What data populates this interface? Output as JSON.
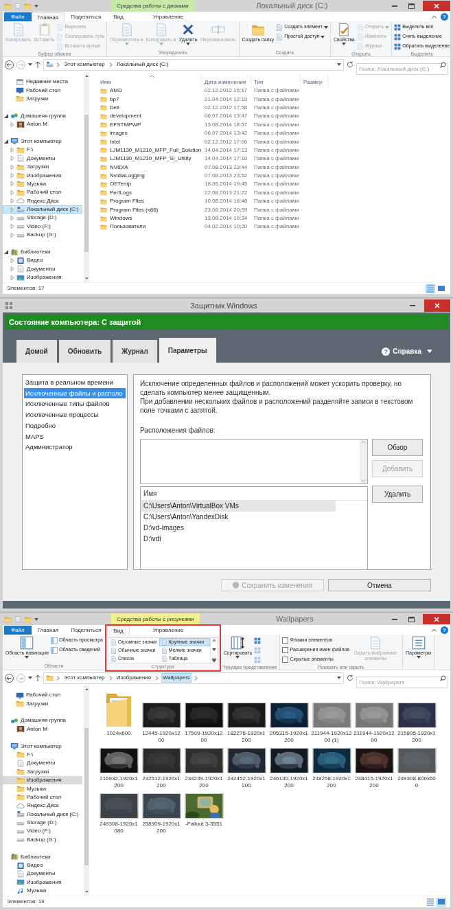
{
  "windows": [
    {
      "kind": "explorer",
      "title": "Локальный диск (C:)",
      "context_tab": {
        "label": "Средства работы с дисками",
        "color": "#c6e9a8"
      },
      "help_icon": "?",
      "tabs": [
        {
          "label": "Файл",
          "kind": "file",
          "selected": false
        },
        {
          "label": "Главная",
          "kind": "normal",
          "selected": true
        },
        {
          "label": "Поделиться",
          "kind": "normal",
          "selected": false
        },
        {
          "label": "Вид",
          "kind": "normal",
          "selected": false
        },
        {
          "label": "Управление",
          "kind": "context",
          "selected": false
        }
      ],
      "groups": [
        {
          "label": "Буфер обмена",
          "kind": "buttons",
          "commands": [
            {
              "label": "Копировать",
              "kind": "large",
              "disabled": true
            },
            {
              "label": "Вставить",
              "kind": "large",
              "disabled": true
            },
            {
              "label": "Вырезать",
              "kind": "small",
              "disabled": true
            },
            {
              "label": "Скопировать путь",
              "kind": "small",
              "disabled": true
            },
            {
              "label": "Вставить ярлык",
              "kind": "small",
              "disabled": true
            }
          ]
        },
        {
          "label": "Упорядочить",
          "kind": "buttons",
          "commands": [
            {
              "label": "Переместить в",
              "kind": "large",
              "disabled": true,
              "menu": true
            },
            {
              "label": "Копировать в",
              "kind": "large",
              "disabled": true,
              "menu": true
            },
            {
              "label": "Удалить",
              "kind": "large",
              "disabled": false,
              "menu": true
            },
            {
              "label": "Переименовать",
              "kind": "large",
              "disabled": true
            }
          ]
        },
        {
          "label": "Создать",
          "kind": "buttons",
          "commands": [
            {
              "label": "Создать папку",
              "kind": "large",
              "disabled": false
            },
            {
              "label": "Создать элемент",
              "kind": "small",
              "disabled": false,
              "menu": true
            },
            {
              "label": "Простой доступ",
              "kind": "small",
              "disabled": false,
              "menu": true
            }
          ]
        },
        {
          "label": "Открыть",
          "kind": "buttons",
          "commands": [
            {
              "label": "Свойства",
              "kind": "large",
              "disabled": false,
              "menu": true
            },
            {
              "label": "Открыть",
              "kind": "small",
              "disabled": true,
              "menu": true
            },
            {
              "label": "Изменить",
              "kind": "small",
              "disabled": true
            },
            {
              "label": "Журнал",
              "kind": "small",
              "disabled": true
            }
          ]
        },
        {
          "label": "Выделить",
          "kind": "buttons",
          "commands": [
            {
              "label": "Выделить все",
              "kind": "small",
              "disabled": false
            },
            {
              "label": "Снять выделение",
              "kind": "small",
              "disabled": false
            },
            {
              "label": "Обратить выделение",
              "kind": "small",
              "disabled": false
            }
          ]
        }
      ],
      "address": {
        "path": [
          {
            "label": "Этот компьютер",
            "selected": false
          },
          {
            "label": "Локальный диск (C:)",
            "selected": false
          }
        ],
        "search_placeholder": "Поиск: Локальный диск (C:)"
      },
      "nav": {
        "focused": true,
        "items": [
          {
            "label": "Недавние места",
            "kind": "place",
            "selected": false
          },
          {
            "label": "Рабочий стол",
            "kind": "desktop",
            "selected": false
          },
          {
            "label": "Загрузки",
            "kind": "folder",
            "selected": false
          },
          {
            "label": "Домашняя группа",
            "kind": "network",
            "selected": false,
            "expanded": true,
            "children": [
              {
                "label": "Anton M",
                "kind": "user",
                "selected": false,
                "expanded": false
              }
            ]
          },
          {
            "label": "Этот компьютер",
            "kind": "computer",
            "selected": false,
            "expanded": true,
            "children": [
              {
                "label": "F:\\",
                "kind": "folder",
                "selected": false,
                "expanded": false
              },
              {
                "label": "Документы",
                "kind": "documents",
                "selected": false,
                "expanded": false
              },
              {
                "label": "Загрузки",
                "kind": "folder",
                "selected": false,
                "expanded": false
              },
              {
                "label": "Изображения",
                "kind": "folder",
                "selected": false,
                "expanded": false
              },
              {
                "label": "Музыка",
                "kind": "folder",
                "selected": false,
                "expanded": false
              },
              {
                "label": "Рабочий стол",
                "kind": "folder",
                "selected": false,
                "expanded": false
              },
              {
                "label": "Яндекс.Диск",
                "kind": "cloud",
                "selected": false,
                "expanded": false
              },
              {
                "label": "Локальный диск (C:)",
                "kind": "system_drive",
                "selected": true,
                "expanded": false
              },
              {
                "label": "Storage (D:)",
                "kind": "drive",
                "selected": false,
                "expanded": false
              },
              {
                "label": "Video (F:)",
                "kind": "drive",
                "selected": false,
                "expanded": false
              },
              {
                "label": "Backup (G:)",
                "kind": "drive",
                "selected": false,
                "expanded": false
              }
            ]
          },
          {
            "label": "Библиотеки",
            "kind": "library",
            "selected": false,
            "expanded": true,
            "children": [
              {
                "label": "Видео",
                "kind": "video",
                "selected": false,
                "expanded": false
              },
              {
                "label": "Документы",
                "kind": "documents",
                "selected": false,
                "expanded": false
              },
              {
                "label": "Изображения",
                "kind": "pictures",
                "selected": false,
                "expanded": false
              }
            ]
          }
        ]
      },
      "view": {
        "kind": "details",
        "columns": [
          {
            "label": "Имя",
            "sorted": true
          },
          {
            "label": "Дата изменения",
            "sorted": false
          },
          {
            "label": "Тип",
            "sorted": false
          },
          {
            "label": "Размер",
            "sorted": false
          }
        ],
        "rows": [
          {
            "name": "AMD",
            "modified": "02.12.2012 16:17",
            "type": "Папка с файлами"
          },
          {
            "name": "bp7",
            "modified": "21.04.2014 12:10",
            "type": "Папка с файлами"
          },
          {
            "name": "Dell",
            "modified": "02.12.2012 17:58",
            "type": "Папка с файлами"
          },
          {
            "name": "development",
            "modified": "06.07.2014 13:47",
            "type": "Папка с файлами"
          },
          {
            "name": "EFSTMPWP",
            "modified": "13.08.2014 18:57",
            "type": "Папка с файлами"
          },
          {
            "name": "images",
            "modified": "06.07.2014 13:42",
            "type": "Папка с файлами"
          },
          {
            "name": "Intel",
            "modified": "02.12.2012 17:06",
            "type": "Папка с файлами"
          },
          {
            "name": "LJM1130_M1210_MFP_Full_Solution",
            "modified": "14.04.2014 17:13",
            "type": "Папка с файлами"
          },
          {
            "name": "LJM1130_M1210_MFP_SI_Utility",
            "modified": "14.04.2014 17:10",
            "type": "Папка с файлами"
          },
          {
            "name": "NVIDIA",
            "modified": "07.08.2013 23:44",
            "type": "Папка с файлами"
          },
          {
            "name": "NvidiaLogging",
            "modified": "07.08.2013 23:52",
            "type": "Папка с файлами"
          },
          {
            "name": "OETemp",
            "modified": "18.06.2014 19:45",
            "type": "Папка с файлами"
          },
          {
            "name": "PerfLogs",
            "modified": "22.08.2013 21:22",
            "type": "Папка с файлами"
          },
          {
            "name": "Program Files",
            "modified": "10.08.2014 16:48",
            "type": "Папка с файлами"
          },
          {
            "name": "Program Files (x86)",
            "modified": "23.08.2014 20:59",
            "type": "Папка с файлами"
          },
          {
            "name": "Windows",
            "modified": "13.08.2014 10:34",
            "type": "Папка с файлами"
          },
          {
            "name": "Пользователи",
            "modified": "04.02.2014 10:20",
            "type": "Папка с файлами"
          }
        ]
      },
      "status": "Элементов: 17",
      "view_buttons": [
        {
          "selected": true
        },
        {
          "selected": false
        }
      ]
    },
    {
      "kind": "defender",
      "title": "Защитник Windows",
      "status": "Состояние компьютера: С защитой",
      "tabs": [
        {
          "label": "Домой",
          "selected": false
        },
        {
          "label": "Обновить",
          "selected": false
        },
        {
          "label": "Журнал",
          "selected": false
        },
        {
          "label": "Параметры",
          "selected": true
        }
      ],
      "help_icon": "?",
      "help": "Справка",
      "sections": [
        {
          "label": "Защита в реальном времени",
          "selected": false
        },
        {
          "label": "Исключенные файлы и располо",
          "selected": true
        },
        {
          "label": "Исключенные типы файлов",
          "selected": false
        },
        {
          "label": "Исключенные процессы",
          "selected": false
        },
        {
          "label": "Подробно",
          "selected": false
        },
        {
          "label": "MAPS",
          "selected": false
        },
        {
          "label": "Администратор",
          "selected": false
        }
      ],
      "description": [
        "Исключение определенных файлов и расположений может ускорить проверку, но сделать компьютер менее защищенным.",
        "При добавлении нескольких файлов и расположений разделяйте записи в текстовом поле точками с запятой."
      ],
      "locations_label": "Расположения файлов:",
      "buttons": [
        {
          "label": "Обзор",
          "disabled": false
        },
        {
          "label": "Добавить",
          "disabled": true
        },
        {
          "label": "Удалить",
          "disabled": false
        }
      ],
      "list": {
        "column": "Имя",
        "rows": [
          {
            "path": "C:\\Users\\Anton\\VirtualBox VMs",
            "selected": true
          },
          {
            "path": "C:\\Users\\Anton\\YandexDisk",
            "selected": false
          },
          {
            "path": "D:\\vd-images",
            "selected": false
          },
          {
            "path": "D:\\vdi",
            "selected": false
          }
        ]
      },
      "footer_buttons": [
        {
          "label": "Сохранить изменения",
          "kind": "save",
          "disabled": true
        },
        {
          "label": "Отмена",
          "kind": "plain",
          "disabled": false
        }
      ]
    },
    {
      "kind": "explorer",
      "title": "Wallpapers",
      "context_tab": {
        "label": "Средства работы с рисунками",
        "color": "#f4ef8c"
      },
      "help_icon": "?",
      "tabs": [
        {
          "label": "Файл",
          "kind": "file",
          "selected": false
        },
        {
          "label": "Главная",
          "kind": "normal",
          "selected": false
        },
        {
          "label": "Поделиться",
          "kind": "normal",
          "selected": false
        },
        {
          "label": "Вид",
          "kind": "normal",
          "selected": true,
          "highlighted": true
        },
        {
          "label": "Управление",
          "kind": "context",
          "selected": false
        }
      ],
      "groups": [
        {
          "label": "Области",
          "kind": "buttons",
          "commands": [
            {
              "label": "Область навигации",
              "kind": "large",
              "disabled": false,
              "menu": true
            },
            {
              "label": "Область просмотра",
              "kind": "small",
              "disabled": false
            },
            {
              "label": "Область сведений",
              "kind": "small",
              "disabled": false
            }
          ]
        },
        {
          "label": "Структура",
          "kind": "gallery",
          "highlighted": true,
          "items": [
            {
              "label": "Огромные значки",
              "selected": false
            },
            {
              "label": "Крупные значки",
              "selected": true
            },
            {
              "label": "Обычные значки",
              "selected": false
            },
            {
              "label": "Мелкие значки",
              "selected": false
            },
            {
              "label": "Список",
              "selected": false
            },
            {
              "label": "Таблица",
              "selected": false
            }
          ]
        },
        {
          "label": "Текущее представление",
          "kind": "buttons",
          "commands": [
            {
              "label": "Сортировать",
              "kind": "large",
              "disabled": false,
              "menu": true
            },
            {
              "kind": "icon",
              "disabled": false
            },
            {
              "kind": "icon",
              "disabled": true
            },
            {
              "kind": "icon",
              "disabled": true
            }
          ]
        },
        {
          "label": "Показать или скрыть",
          "kind": "buttons",
          "commands": [
            {
              "label": "Флажки элементов",
              "kind": "checkbox",
              "checked": false
            },
            {
              "label": "Расширения имен файлов",
              "kind": "checkbox",
              "checked": false
            },
            {
              "label": "Скрытые элементы",
              "kind": "checkbox",
              "checked": false
            },
            {
              "label": "Скрыть выбранные элементы",
              "kind": "large",
              "disabled": true
            }
          ]
        },
        {
          "kind": "buttons",
          "commands": [
            {
              "label": "Параметры",
              "kind": "large",
              "disabled": false,
              "menu": true
            }
          ]
        }
      ],
      "address": {
        "path": [
          {
            "label": "Этот компьютер",
            "selected": false
          },
          {
            "label": "Изображения",
            "selected": false
          },
          {
            "label": "Wallpapers",
            "selected": true
          }
        ],
        "search_placeholder": "Поиск: Wallpapers"
      },
      "nav": {
        "focused": false,
        "items": [
          {
            "label": "Рабочий стол",
            "kind": "desktop",
            "selected": false
          },
          {
            "label": "Загрузки",
            "kind": "folder",
            "selected": false
          },
          {
            "label": "Домашняя группа",
            "kind": "network",
            "selected": false,
            "children": [
              {
                "label": "Anton M",
                "kind": "user",
                "selected": false
              }
            ]
          },
          {
            "label": "Этот компьютер",
            "kind": "computer",
            "selected": false,
            "children": [
              {
                "label": "F:\\",
                "kind": "folder",
                "selected": false
              },
              {
                "label": "Документы",
                "kind": "documents",
                "selected": false
              },
              {
                "label": "Загрузки",
                "kind": "folder",
                "selected": false
              },
              {
                "label": "Изображения",
                "kind": "folder",
                "selected": true
              },
              {
                "label": "Музыка",
                "kind": "folder",
                "selected": false
              },
              {
                "label": "Рабочий стол",
                "kind": "folder",
                "selected": false
              },
              {
                "label": "Яндекс.Диск",
                "kind": "cloud",
                "selected": false
              },
              {
                "label": "Локальный диск (C:)",
                "kind": "system_drive",
                "selected": false
              },
              {
                "label": "Storage (D:)",
                "kind": "drive",
                "selected": false
              },
              {
                "label": "Video (F:)",
                "kind": "drive",
                "selected": false
              },
              {
                "label": "Backup (G:)",
                "kind": "drive",
                "selected": false
              }
            ]
          },
          {
            "label": "Библиотеки",
            "kind": "library",
            "selected": false,
            "children": [
              {
                "label": "Видео",
                "kind": "video",
                "selected": false
              },
              {
                "label": "Документы",
                "kind": "documents",
                "selected": false
              },
              {
                "label": "Изображения",
                "kind": "pictures",
                "selected": false
              },
              {
                "label": "Музыка",
                "kind": "music",
                "selected": false
              }
            ]
          }
        ]
      },
      "view": {
        "kind": "icons",
        "items": [
          {
            "label": "1024x600",
            "kind": "folder"
          },
          {
            "label": "12445-1920x1200",
            "kind": "picture"
          },
          {
            "label": "17509-1920x1200",
            "kind": "picture"
          },
          {
            "label": "182276-1920x1200",
            "kind": "picture"
          },
          {
            "label": "205315-1920x1200",
            "kind": "picture"
          },
          {
            "label": "211944-1920x1200 (1)",
            "kind": "picture"
          },
          {
            "label": "211944-1920x1200",
            "kind": "picture"
          },
          {
            "label": "215805-1920x1200",
            "kind": "picture"
          },
          {
            "label": "216932-1920x1200",
            "kind": "picture"
          },
          {
            "label": "232512-1920x1200",
            "kind": "picture"
          },
          {
            "label": "234239-1920x1200",
            "kind": "picture"
          },
          {
            "label": "242452-1920x1200",
            "kind": "picture"
          },
          {
            "label": "246130-1920x1200",
            "kind": "picture"
          },
          {
            "label": "248258-1920x1200",
            "kind": "picture"
          },
          {
            "label": "248415-1920x1200",
            "kind": "picture"
          },
          {
            "label": "249308-800x600",
            "kind": "picture"
          },
          {
            "label": "249308-1920x1080",
            "kind": "picture"
          },
          {
            "label": "258909-1920x1200",
            "kind": "picture"
          },
          {
            "label": "-Fallout 3-3551",
            "kind": "picture"
          }
        ]
      },
      "status": "Элементов: 19",
      "view_buttons": [
        {
          "selected": false
        },
        {
          "selected": true
        }
      ]
    }
  ]
}
